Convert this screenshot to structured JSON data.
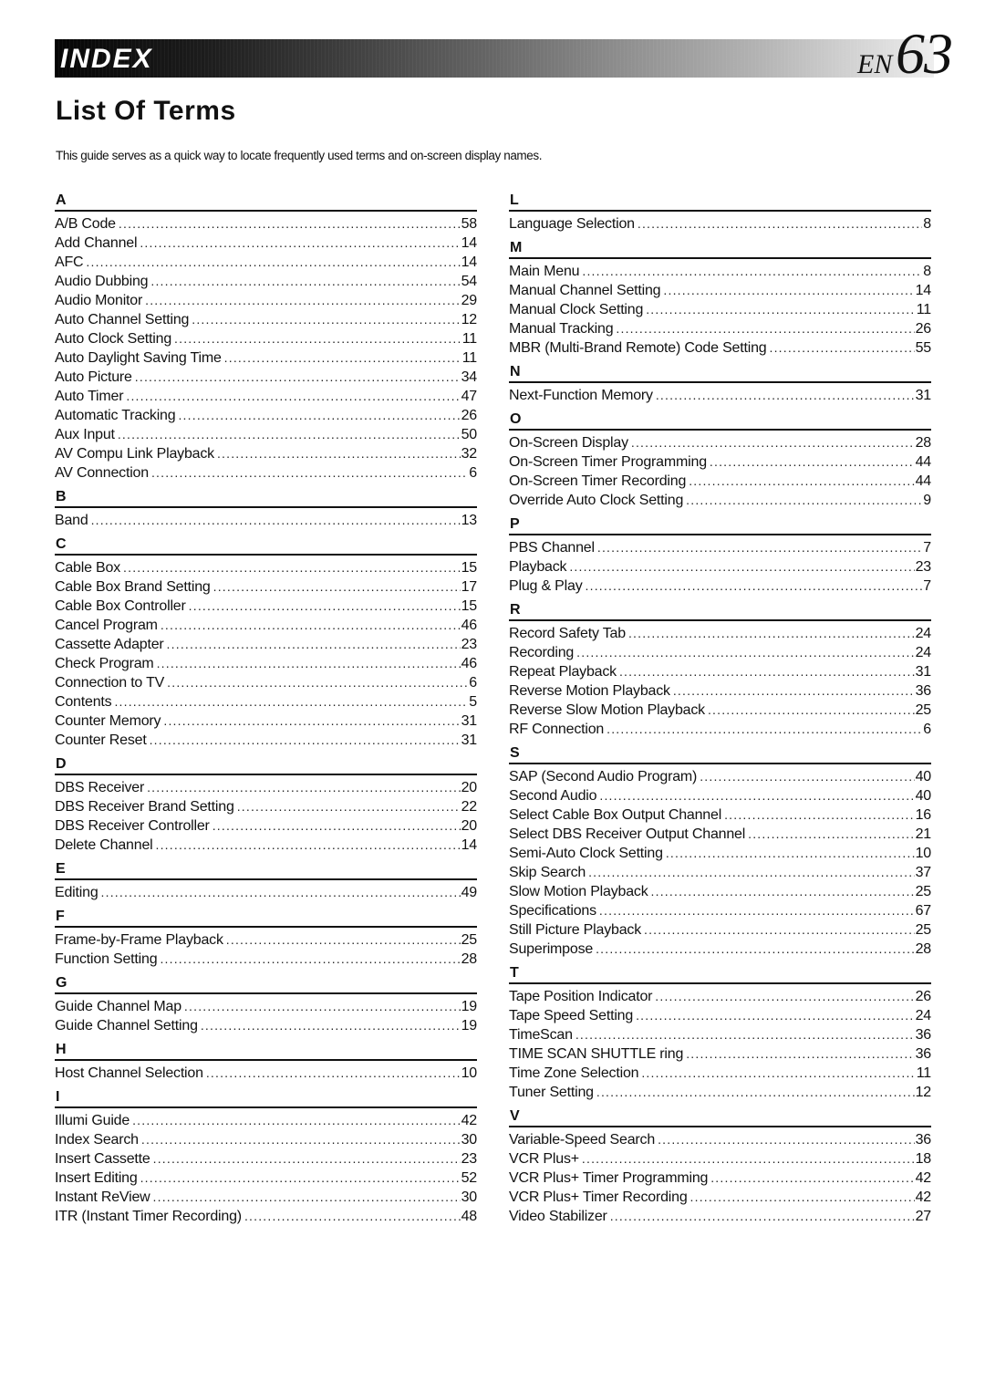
{
  "header": {
    "section_label": "INDEX",
    "language": "EN",
    "page_number": "63"
  },
  "title": "List Of Terms",
  "intro": "This guide serves as a quick way to locate frequently used terms and on-screen display names.",
  "columns": [
    {
      "sections": [
        {
          "letter": "A",
          "entries": [
            {
              "term": "A/B Code",
              "page": "58"
            },
            {
              "term": "Add Channel",
              "page": "14"
            },
            {
              "term": "AFC",
              "page": "14"
            },
            {
              "term": "Audio Dubbing",
              "page": "54"
            },
            {
              "term": "Audio Monitor",
              "page": "29"
            },
            {
              "term": "Auto Channel Setting",
              "page": "12"
            },
            {
              "term": "Auto Clock Setting",
              "page": "11"
            },
            {
              "term": "Auto Daylight Saving Time",
              "page": "11"
            },
            {
              "term": "Auto Picture",
              "page": "34"
            },
            {
              "term": "Auto Timer",
              "page": "47"
            },
            {
              "term": "Automatic Tracking",
              "page": "26"
            },
            {
              "term": "Aux Input",
              "page": "50"
            },
            {
              "term": "AV Compu Link Playback",
              "page": "32"
            },
            {
              "term": "AV Connection",
              "page": "6"
            }
          ]
        },
        {
          "letter": "B",
          "entries": [
            {
              "term": "Band",
              "page": "13"
            }
          ]
        },
        {
          "letter": "C",
          "entries": [
            {
              "term": "Cable Box",
              "page": "15"
            },
            {
              "term": "Cable Box Brand Setting",
              "page": "17"
            },
            {
              "term": "Cable Box Controller",
              "page": "15"
            },
            {
              "term": "Cancel Program",
              "page": "46"
            },
            {
              "term": "Cassette Adapter",
              "page": "23"
            },
            {
              "term": "Check Program",
              "page": "46"
            },
            {
              "term": "Connection to TV",
              "page": "6"
            },
            {
              "term": "Contents",
              "page": "5"
            },
            {
              "term": "Counter Memory",
              "page": "31"
            },
            {
              "term": "Counter Reset",
              "page": "31"
            }
          ]
        },
        {
          "letter": "D",
          "entries": [
            {
              "term": "DBS Receiver",
              "page": "20"
            },
            {
              "term": "DBS Receiver Brand Setting",
              "page": "22"
            },
            {
              "term": "DBS Receiver Controller",
              "page": "20"
            },
            {
              "term": "Delete Channel",
              "page": "14"
            }
          ]
        },
        {
          "letter": "E",
          "entries": [
            {
              "term": "Editing",
              "page": "49"
            }
          ]
        },
        {
          "letter": "F",
          "entries": [
            {
              "term": "Frame-by-Frame Playback",
              "page": "25"
            },
            {
              "term": "Function Setting",
              "page": "28"
            }
          ]
        },
        {
          "letter": "G",
          "entries": [
            {
              "term": "Guide Channel Map",
              "page": "19"
            },
            {
              "term": "Guide Channel Setting",
              "page": "19"
            }
          ]
        },
        {
          "letter": "H",
          "entries": [
            {
              "term": "Host Channel Selection",
              "page": "10"
            }
          ]
        },
        {
          "letter": "I",
          "entries": [
            {
              "term": "Illumi Guide",
              "page": "42"
            },
            {
              "term": "Index Search",
              "page": "30"
            },
            {
              "term": "Insert Cassette",
              "page": "23"
            },
            {
              "term": "Insert Editing",
              "page": "52"
            },
            {
              "term": "Instant ReView",
              "page": "30"
            },
            {
              "term": "ITR (Instant Timer Recording)",
              "page": "48"
            }
          ]
        }
      ]
    },
    {
      "sections": [
        {
          "letter": "L",
          "entries": [
            {
              "term": "Language Selection",
              "page": "8"
            }
          ]
        },
        {
          "letter": "M",
          "entries": [
            {
              "term": "Main Menu",
              "page": "8"
            },
            {
              "term": "Manual Channel Setting",
              "page": "14"
            },
            {
              "term": "Manual Clock Setting",
              "page": "11"
            },
            {
              "term": "Manual Tracking",
              "page": "26"
            },
            {
              "term": "MBR (Multi-Brand Remote) Code Setting",
              "page": "55"
            }
          ]
        },
        {
          "letter": "N",
          "entries": [
            {
              "term": "Next-Function Memory",
              "page": "31"
            }
          ]
        },
        {
          "letter": "O",
          "entries": [
            {
              "term": "On-Screen Display",
              "page": "28"
            },
            {
              "term": "On-Screen Timer Programming",
              "page": "44"
            },
            {
              "term": "On-Screen Timer Recording",
              "page": "44"
            },
            {
              "term": "Override Auto Clock Setting",
              "page": "9"
            }
          ]
        },
        {
          "letter": "P",
          "entries": [
            {
              "term": "PBS Channel",
              "page": "7"
            },
            {
              "term": "Playback",
              "page": "23"
            },
            {
              "term": "Plug & Play",
              "page": "7"
            }
          ]
        },
        {
          "letter": "R",
          "entries": [
            {
              "term": "Record Safety Tab",
              "page": "24"
            },
            {
              "term": "Recording",
              "page": "24"
            },
            {
              "term": "Repeat Playback",
              "page": "31"
            },
            {
              "term": "Reverse Motion Playback",
              "page": "36"
            },
            {
              "term": "Reverse Slow Motion Playback",
              "page": "25"
            },
            {
              "term": "RF Connection",
              "page": "6"
            }
          ]
        },
        {
          "letter": "S",
          "entries": [
            {
              "term": "SAP (Second Audio Program)",
              "page": "40"
            },
            {
              "term": "Second Audio",
              "page": "40"
            },
            {
              "term": "Select Cable Box Output Channel",
              "page": "16"
            },
            {
              "term": "Select DBS Receiver Output Channel",
              "page": "21"
            },
            {
              "term": "Semi-Auto Clock Setting",
              "page": "10"
            },
            {
              "term": "Skip Search",
              "page": "37"
            },
            {
              "term": "Slow Motion Playback",
              "page": "25"
            },
            {
              "term": "Specifications",
              "page": "67"
            },
            {
              "term": "Still Picture Playback",
              "page": "25"
            },
            {
              "term": "Superimpose",
              "page": "28"
            }
          ]
        },
        {
          "letter": "T",
          "entries": [
            {
              "term": "Tape Position Indicator",
              "page": "26"
            },
            {
              "term": "Tape Speed Setting",
              "page": "24"
            },
            {
              "term": "TimeScan",
              "page": "36"
            },
            {
              "term": "TIME SCAN SHUTTLE ring",
              "page": "36"
            },
            {
              "term": "Time Zone Selection",
              "page": "11"
            },
            {
              "term": "Tuner Setting",
              "page": "12"
            }
          ]
        },
        {
          "letter": "V",
          "entries": [
            {
              "term": "Variable-Speed Search",
              "page": "36"
            },
            {
              "term": "VCR Plus+",
              "page": "18"
            },
            {
              "term": "VCR Plus+ Timer Programming",
              "page": "42"
            },
            {
              "term": "VCR Plus+ Timer Recording",
              "page": "42"
            },
            {
              "term": "Video Stabilizer",
              "page": "27"
            }
          ]
        }
      ]
    }
  ]
}
